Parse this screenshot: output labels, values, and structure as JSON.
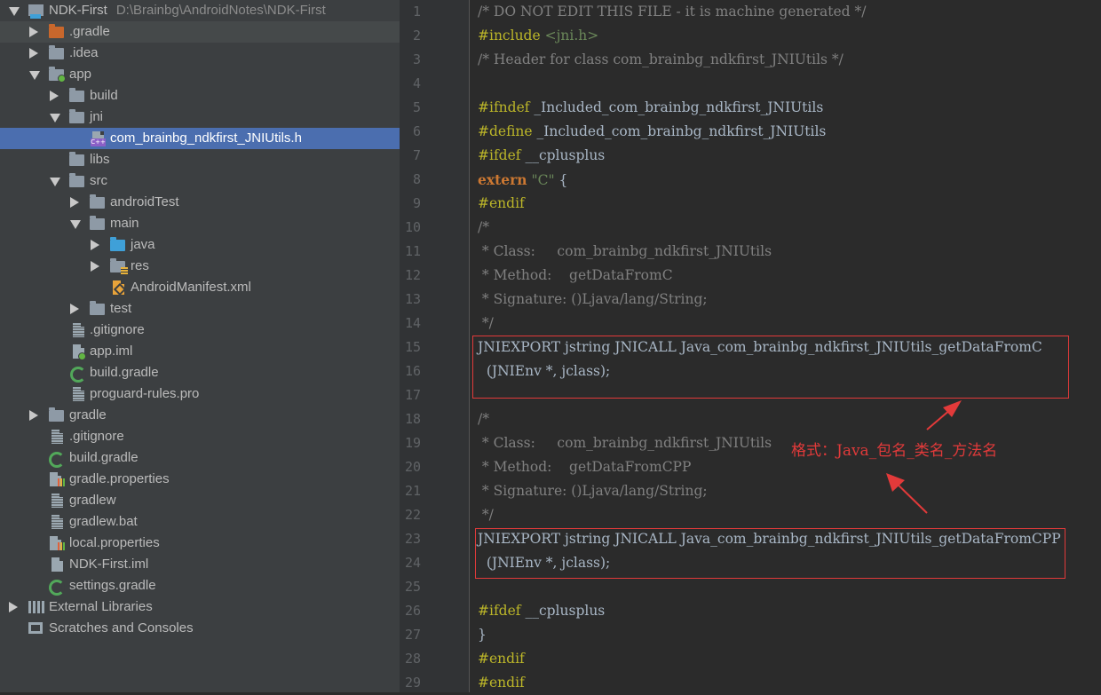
{
  "project": {
    "name": "NDK-First",
    "path": "D:\\Brainbg\\AndroidNotes\\NDK-First"
  },
  "tree": [
    {
      "label": ".gradle"
    },
    {
      "label": ".idea"
    },
    {
      "label": "app"
    },
    {
      "label": "build"
    },
    {
      "label": "jni"
    },
    {
      "label": "com_brainbg_ndkfirst_JNIUtils.h"
    },
    {
      "label": "libs"
    },
    {
      "label": "src"
    },
    {
      "label": "androidTest"
    },
    {
      "label": "main"
    },
    {
      "label": "java"
    },
    {
      "label": "res"
    },
    {
      "label": "AndroidManifest.xml"
    },
    {
      "label": "test"
    },
    {
      "label": ".gitignore"
    },
    {
      "label": "app.iml"
    },
    {
      "label": "build.gradle"
    },
    {
      "label": "proguard-rules.pro"
    },
    {
      "label": "gradle"
    },
    {
      "label": ".gitignore"
    },
    {
      "label": "build.gradle"
    },
    {
      "label": "gradle.properties"
    },
    {
      "label": "gradlew"
    },
    {
      "label": "gradlew.bat"
    },
    {
      "label": "local.properties"
    },
    {
      "label": "NDK-First.iml"
    },
    {
      "label": "settings.gradle"
    },
    {
      "label": "External Libraries"
    },
    {
      "label": "Scratches and Consoles"
    }
  ],
  "line_numbers": [
    "1",
    "2",
    "3",
    "4",
    "5",
    "6",
    "7",
    "8",
    "9",
    "10",
    "11",
    "12",
    "13",
    "14",
    "15",
    "16",
    "17",
    "18",
    "19",
    "20",
    "21",
    "22",
    "23",
    "24",
    "25",
    "26",
    "27",
    "28",
    "29"
  ],
  "code": {
    "l1": "/* DO NOT EDIT THIS FILE - it is machine generated */",
    "l2_kw": "#include",
    "l2_rest": " <jni.h>",
    "l3": "/* Header for class com_brainbg_ndkfirst_JNIUtils */",
    "l5_kw": "#ifndef",
    "l5_rest": " _Included_com_brainbg_ndkfirst_JNIUtils",
    "l6_kw": "#define",
    "l6_rest": " _Included_com_brainbg_ndkfirst_JNIUtils",
    "l7_kw": "#ifdef",
    "l7_rest": " __cplusplus",
    "l8_kw": "extern",
    "l8_str": " \"C\"",
    "l8_rest": " {",
    "l9": "#endif",
    "l10": "/*",
    "l11": " * Class:     com_brainbg_ndkfirst_JNIUtils",
    "l12": " * Method:    getDataFromC",
    "l13": " * Signature: ()Ljava/lang/String;",
    "l14": " */",
    "l15": "JNIEXPORT jstring JNICALL Java_com_brainbg_ndkfirst_JNIUtils_getDataFromC",
    "l16": "  (JNIEnv *, jclass);",
    "l18": "/*",
    "l19": " * Class:     com_brainbg_ndkfirst_JNIUtils",
    "l20": " * Method:    getDataFromCPP",
    "l21": " * Signature: ()Ljava/lang/String;",
    "l22": " */",
    "l23": "JNIEXPORT jstring JNICALL Java_com_brainbg_ndkfirst_JNIUtils_getDataFromCPP",
    "l24": "  (JNIEnv *, jclass);",
    "l26_kw": "#ifdef",
    "l26_rest": " __cplusplus",
    "l27": "}",
    "l28": "#endif",
    "l29": "#endif"
  },
  "annotation": "格式：Java_包名_类名_方法名",
  "colors": {
    "annotation": "#e23a3a",
    "selection": "#4b6eaf",
    "comment": "#808080",
    "keyword": "#cc7832",
    "preprocessor": "#bbb529",
    "string": "#6a8759"
  }
}
